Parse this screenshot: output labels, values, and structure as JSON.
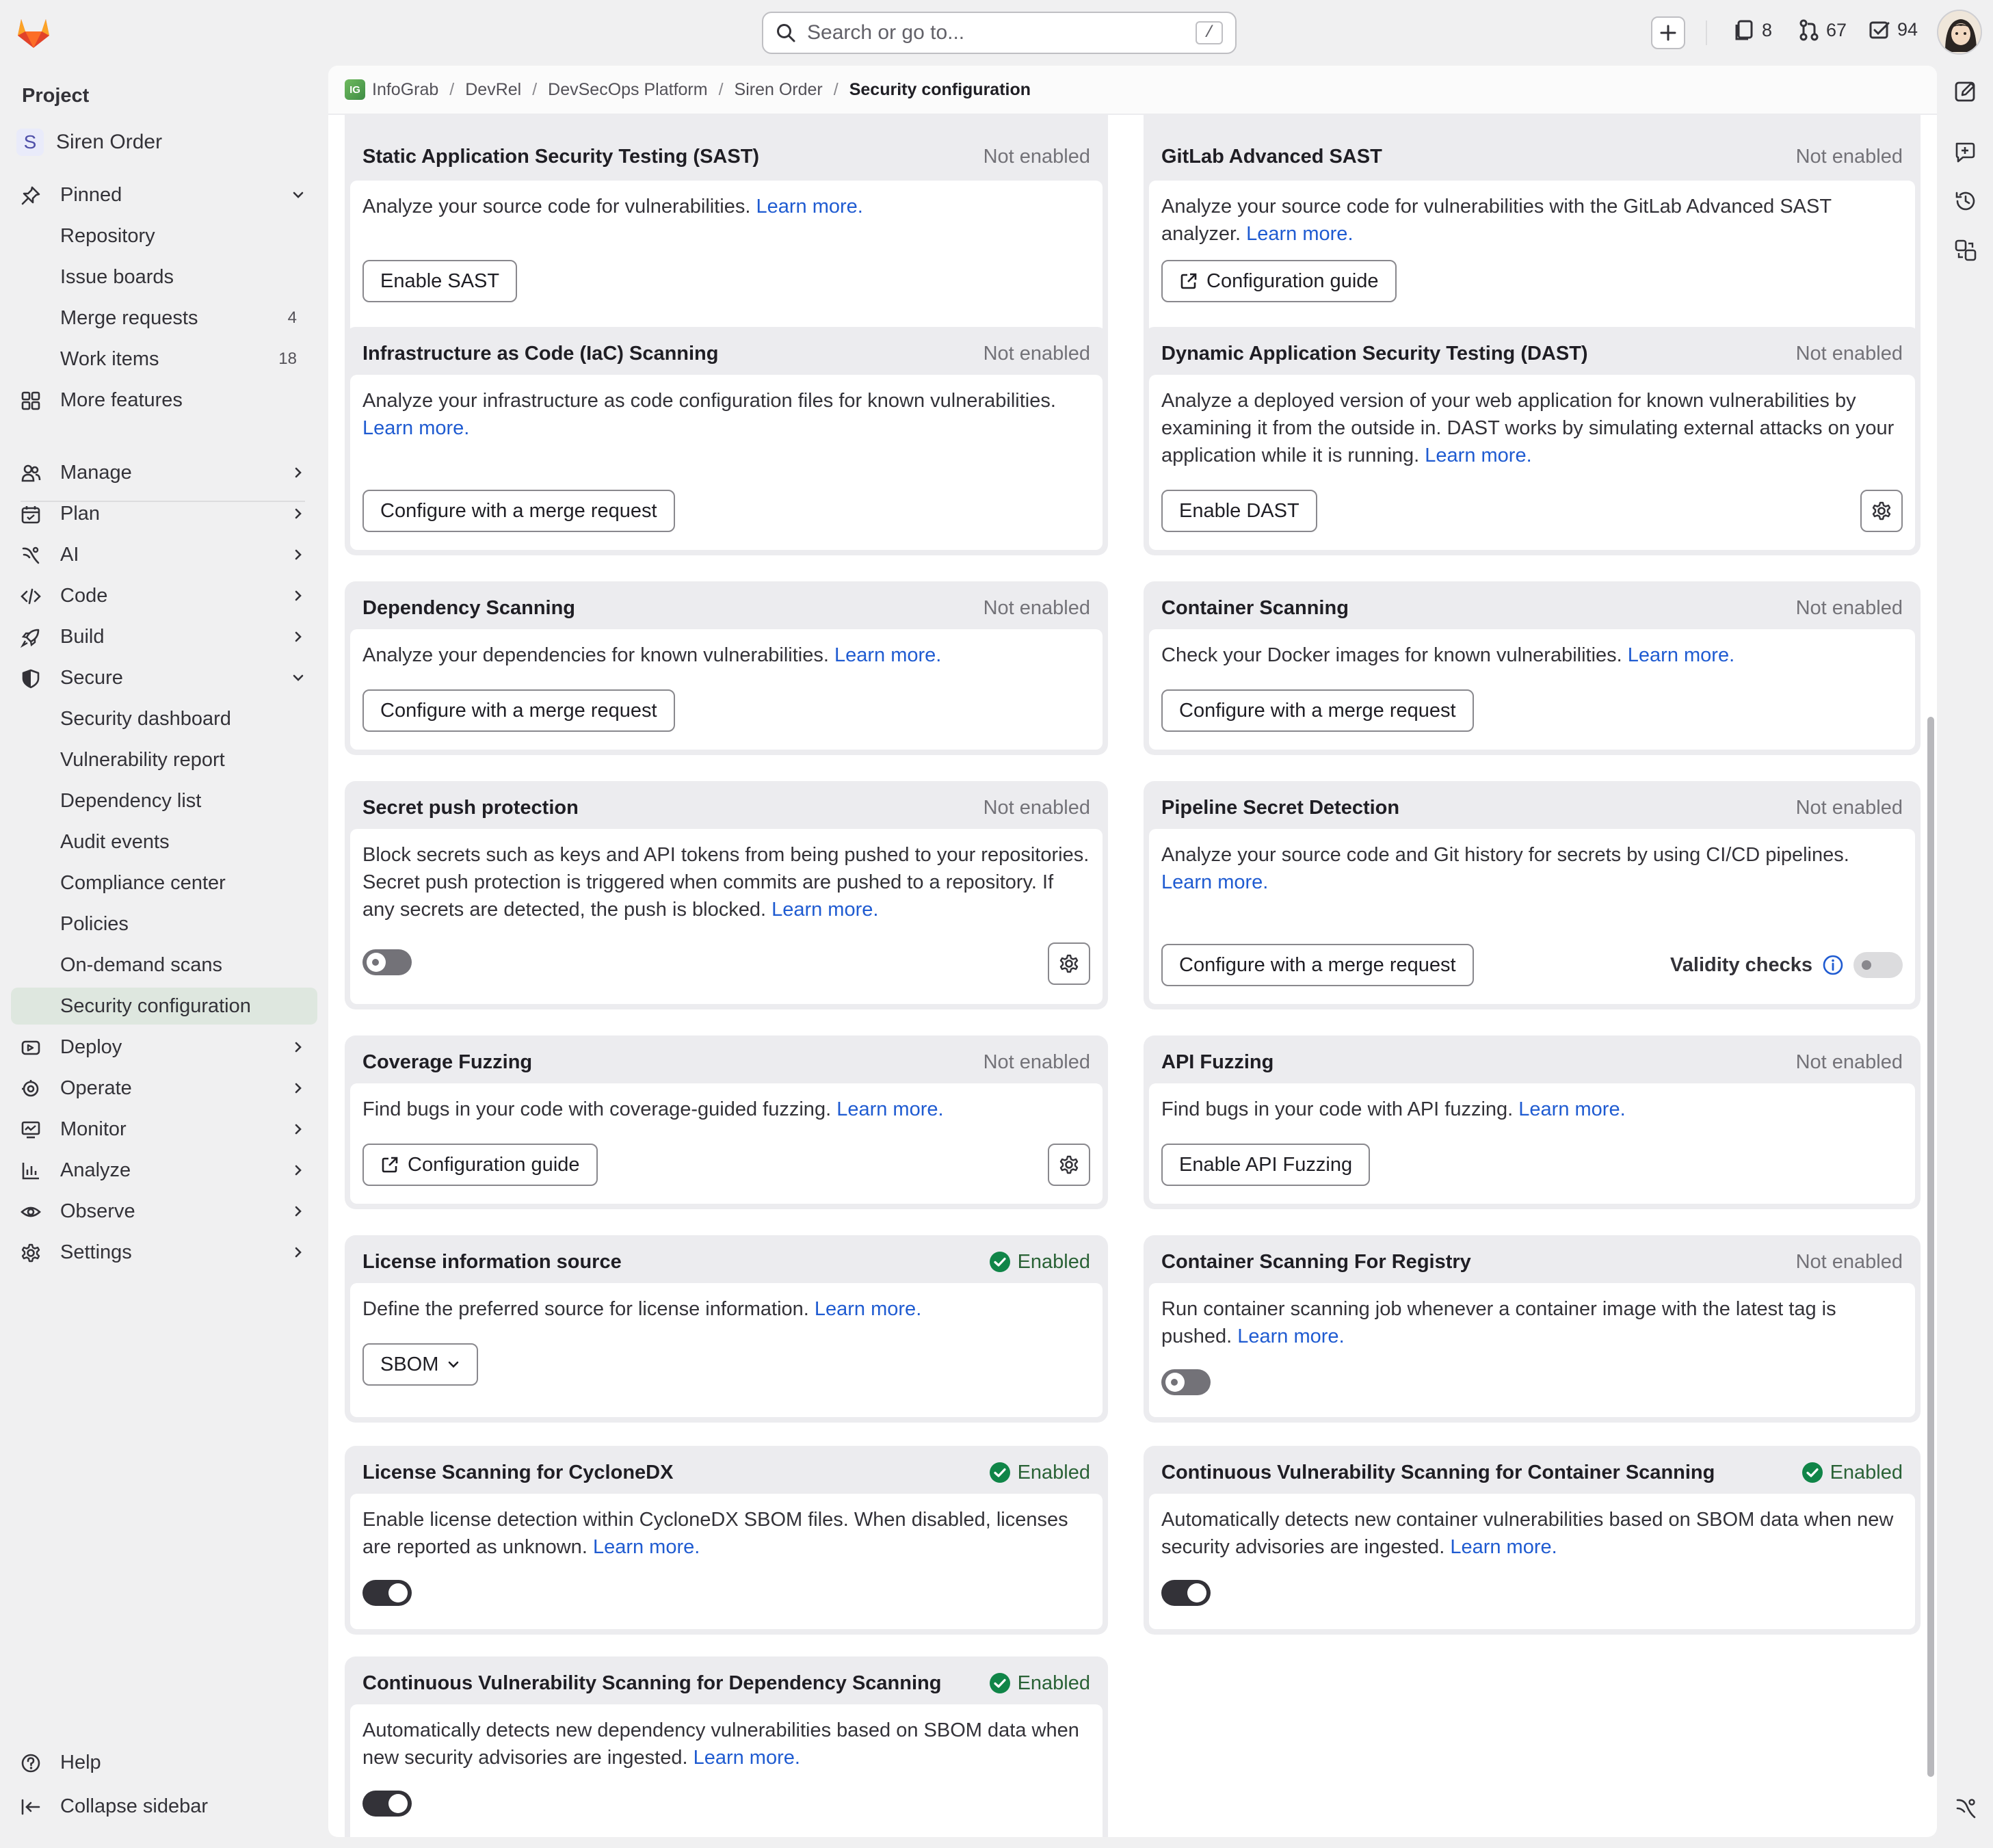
{
  "topbar": {
    "search_placeholder": "Search or go to...",
    "search_shortcut": "/",
    "issues_count": "8",
    "merge_requests_count": "67",
    "todos_count": "94"
  },
  "sidebar": {
    "heading": "Project",
    "project_initial": "S",
    "project_name": "Siren Order",
    "pinned_label": "Pinned",
    "pinned": [
      {
        "label": "Repository",
        "count": ""
      },
      {
        "label": "Issue boards",
        "count": ""
      },
      {
        "label": "Merge requests",
        "count": "4"
      },
      {
        "label": "Work items",
        "count": "18"
      }
    ],
    "more_features": "More features",
    "sections": {
      "manage": "Manage",
      "plan": "Plan",
      "ai": "AI",
      "code": "Code",
      "build": "Build",
      "secure": "Secure",
      "deploy": "Deploy",
      "operate": "Operate",
      "monitor": "Monitor",
      "analyze": "Analyze",
      "observe": "Observe",
      "settings": "Settings"
    },
    "secure_items": [
      "Security dashboard",
      "Vulnerability report",
      "Dependency list",
      "Audit events",
      "Compliance center",
      "Policies",
      "On-demand scans",
      "Security configuration"
    ],
    "help": "Help",
    "collapse": "Collapse sidebar"
  },
  "breadcrumb": [
    "InfoGrab",
    "DevRel",
    "DevSecOps Platform",
    "Siren Order",
    "Security configuration"
  ],
  "breadcrumb_logo": "IG",
  "learn_more": "Learn more.",
  "cards": {
    "sast": {
      "title": "Static Application Security Testing (SAST)",
      "status": "Not enabled",
      "desc": "Analyze your source code for vulnerabilities.",
      "button": "Enable SAST"
    },
    "adv_sast": {
      "title": "GitLab Advanced SAST",
      "status": "Not enabled",
      "desc": "Analyze your source code for vulnerabilities with the GitLab Advanced SAST analyzer.",
      "button": "Configuration guide"
    },
    "iac": {
      "title": "Infrastructure as Code (IaC) Scanning",
      "status": "Not enabled",
      "desc": "Analyze your infrastructure as code configuration files for known vulnerabilities.",
      "button": "Configure with a merge request"
    },
    "dast": {
      "title": "Dynamic Application Security Testing (DAST)",
      "status": "Not enabled",
      "desc": "Analyze a deployed version of your web application for known vulnerabilities by examining it from the outside in. DAST works by simulating external attacks on your application while it is running.",
      "button": "Enable DAST"
    },
    "dependency": {
      "title": "Dependency Scanning",
      "status": "Not enabled",
      "desc": "Analyze your dependencies for known vulnerabilities.",
      "button": "Configure with a merge request"
    },
    "container": {
      "title": "Container Scanning",
      "status": "Not enabled",
      "desc": "Check your Docker images for known vulnerabilities.",
      "button": "Configure with a merge request"
    },
    "secret_push": {
      "title": "Secret push protection",
      "status": "Not enabled",
      "desc": "Block secrets such as keys and API tokens from being pushed to your repositories. Secret push protection is triggered when commits are pushed to a repository. If any secrets are detected, the push is blocked."
    },
    "pipeline_secret": {
      "title": "Pipeline Secret Detection",
      "status": "Not enabled",
      "desc": "Analyze your source code and Git history for secrets by using CI/CD pipelines.",
      "button": "Configure with a merge request",
      "validity_label": "Validity checks"
    },
    "coverage": {
      "title": "Coverage Fuzzing",
      "status": "Not enabled",
      "desc": "Find bugs in your code with coverage-guided fuzzing.",
      "button": "Configuration guide"
    },
    "api_fuzzing": {
      "title": "API Fuzzing",
      "status": "Not enabled",
      "desc": "Find bugs in your code with API fuzzing.",
      "button": "Enable API Fuzzing"
    },
    "license_source": {
      "title": "License information source",
      "status": "Enabled",
      "desc": "Define the preferred source for license information.",
      "select_value": "SBOM"
    },
    "container_registry": {
      "title": "Container Scanning For Registry",
      "status": "Not enabled",
      "desc": "Run container scanning job whenever a container image with the latest tag is pushed."
    },
    "license_cyclonedx": {
      "title": "License Scanning for CycloneDX",
      "status": "Enabled",
      "desc": "Enable license detection within CycloneDX SBOM files. When disabled, licenses are reported as unknown."
    },
    "cvs_container": {
      "title": "Continuous Vulnerability Scanning for Container Scanning",
      "status": "Enabled",
      "desc": "Automatically detects new container vulnerabilities based on SBOM data when new security advisories are ingested."
    },
    "cvs_dependency": {
      "title": "Continuous Vulnerability Scanning for Dependency Scanning",
      "status": "Enabled",
      "desc": "Automatically detects new dependency vulnerabilities based on SBOM data when new security advisories are ingested."
    }
  }
}
